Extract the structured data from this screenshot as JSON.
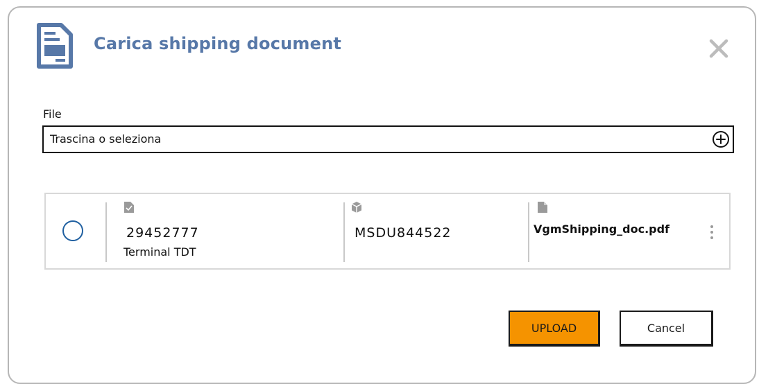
{
  "dialog": {
    "title": "Carica shipping document",
    "title_icon": "document-icon",
    "close_icon": "close-icon"
  },
  "file_field": {
    "label": "File",
    "placeholder": "Trascina o seleziona",
    "add_icon": "add-circle-icon"
  },
  "document_row": {
    "selected": false,
    "booking": {
      "icon": "document-check-icon",
      "number": "29452777",
      "terminal": "Terminal TDT"
    },
    "container": {
      "icon": "cube-icon",
      "code": "MSDU844522"
    },
    "file": {
      "icon": "file-icon",
      "name": "VgmShipping_doc.pdf"
    },
    "menu_icon": "kebab-menu-icon"
  },
  "actions": {
    "upload_label": "UPLOAD",
    "cancel_label": "Cancel"
  },
  "colors": {
    "title": "#5778a8",
    "upload_button": "#f59300",
    "radio": "#1f5fa0",
    "icon_gray": "#9a9a9a"
  }
}
